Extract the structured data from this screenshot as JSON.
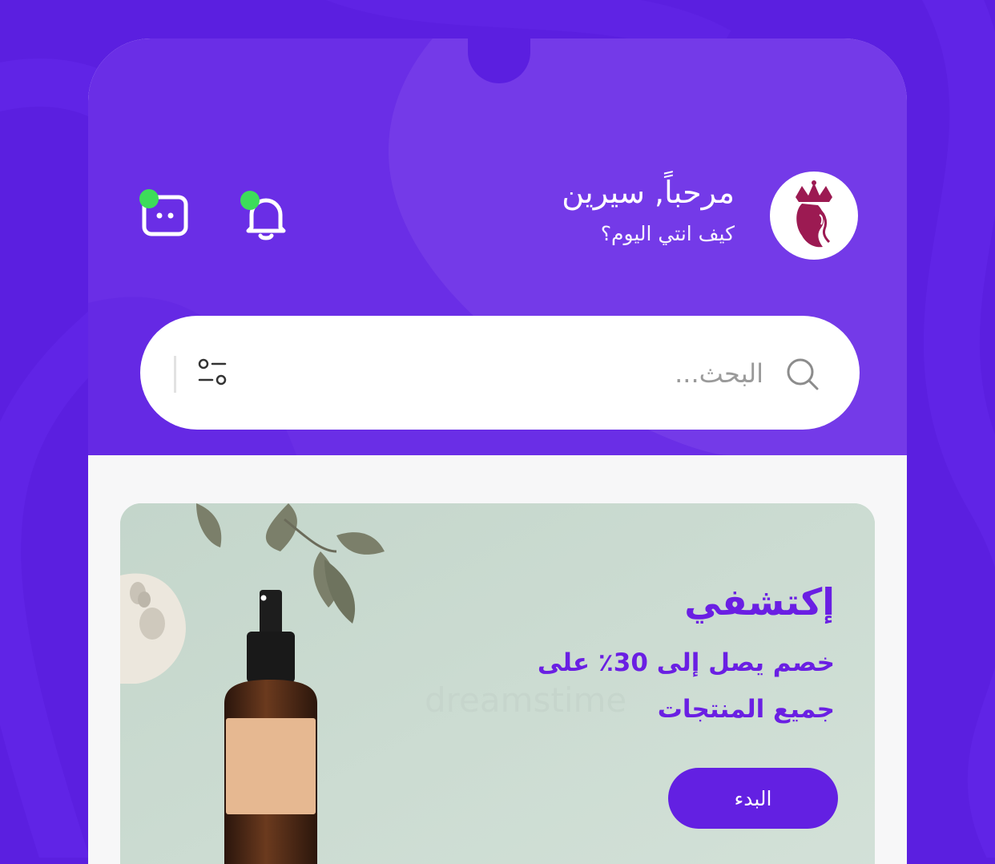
{
  "greeting": {
    "title": "مرحباً, سيرين",
    "subtitle": "كيف انتي اليوم؟"
  },
  "icons": {
    "avatar": "queen-crown-logo",
    "notifications": "bell-icon",
    "messages": "chat-bubble-icon",
    "search": "search-icon",
    "filter": "filter-sliders-icon"
  },
  "search": {
    "placeholder": "البحث..."
  },
  "banner": {
    "title": "إكتشفي",
    "line1": "خصم يصل إلى 30٪ على",
    "line2": "جميع المنتجات",
    "button": "البدء"
  },
  "colors": {
    "background": "#5b1fe0",
    "header": "#6a2ee6",
    "accent": "#6320e2",
    "badge": "#3ddc5a",
    "banner": "#c9d9cf"
  }
}
